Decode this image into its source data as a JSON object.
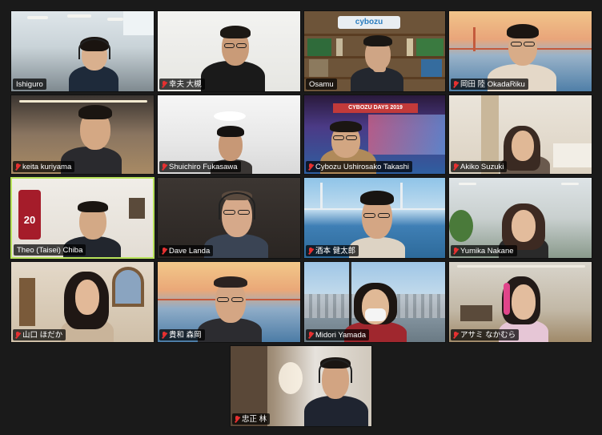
{
  "participants": [
    {
      "name": "Ishiguro",
      "muted": false
    },
    {
      "name": "幸夫 大槻",
      "muted": true
    },
    {
      "name": "Osamu",
      "muted": false,
      "sign": "cybozu"
    },
    {
      "name": "岡田 陸 OkadaRiku",
      "muted": true
    },
    {
      "name": "keita kuriyama",
      "muted": true
    },
    {
      "name": "Shuichiro Fukasawa",
      "muted": true
    },
    {
      "name": "Cybozu Ushirosako Takashi",
      "muted": true,
      "banner": "CYBOZU DAYS 2019"
    },
    {
      "name": "Akiko Suzuki",
      "muted": true
    },
    {
      "name": "Theo (Taisei) Chiba",
      "muted": false,
      "active_speaker": true,
      "jersey_number": "20"
    },
    {
      "name": "Dave Landa",
      "muted": true
    },
    {
      "name": "酒本 健太郎",
      "muted": true
    },
    {
      "name": "Yumika Nakane",
      "muted": true
    },
    {
      "name": "山口 ほだか",
      "muted": true
    },
    {
      "name": "貴和 森岡",
      "muted": true
    },
    {
      "name": "Midori Yamada",
      "muted": true
    },
    {
      "name": "アサミ なかむら",
      "muted": true
    },
    {
      "name": "忠正 林",
      "muted": true
    }
  ],
  "colors": {
    "background": "#1a1a1a",
    "active_speaker_border": "#b8e35a",
    "muted_icon": "#e63030",
    "name_tag_bg": "rgba(0,0,0,0.72)"
  }
}
